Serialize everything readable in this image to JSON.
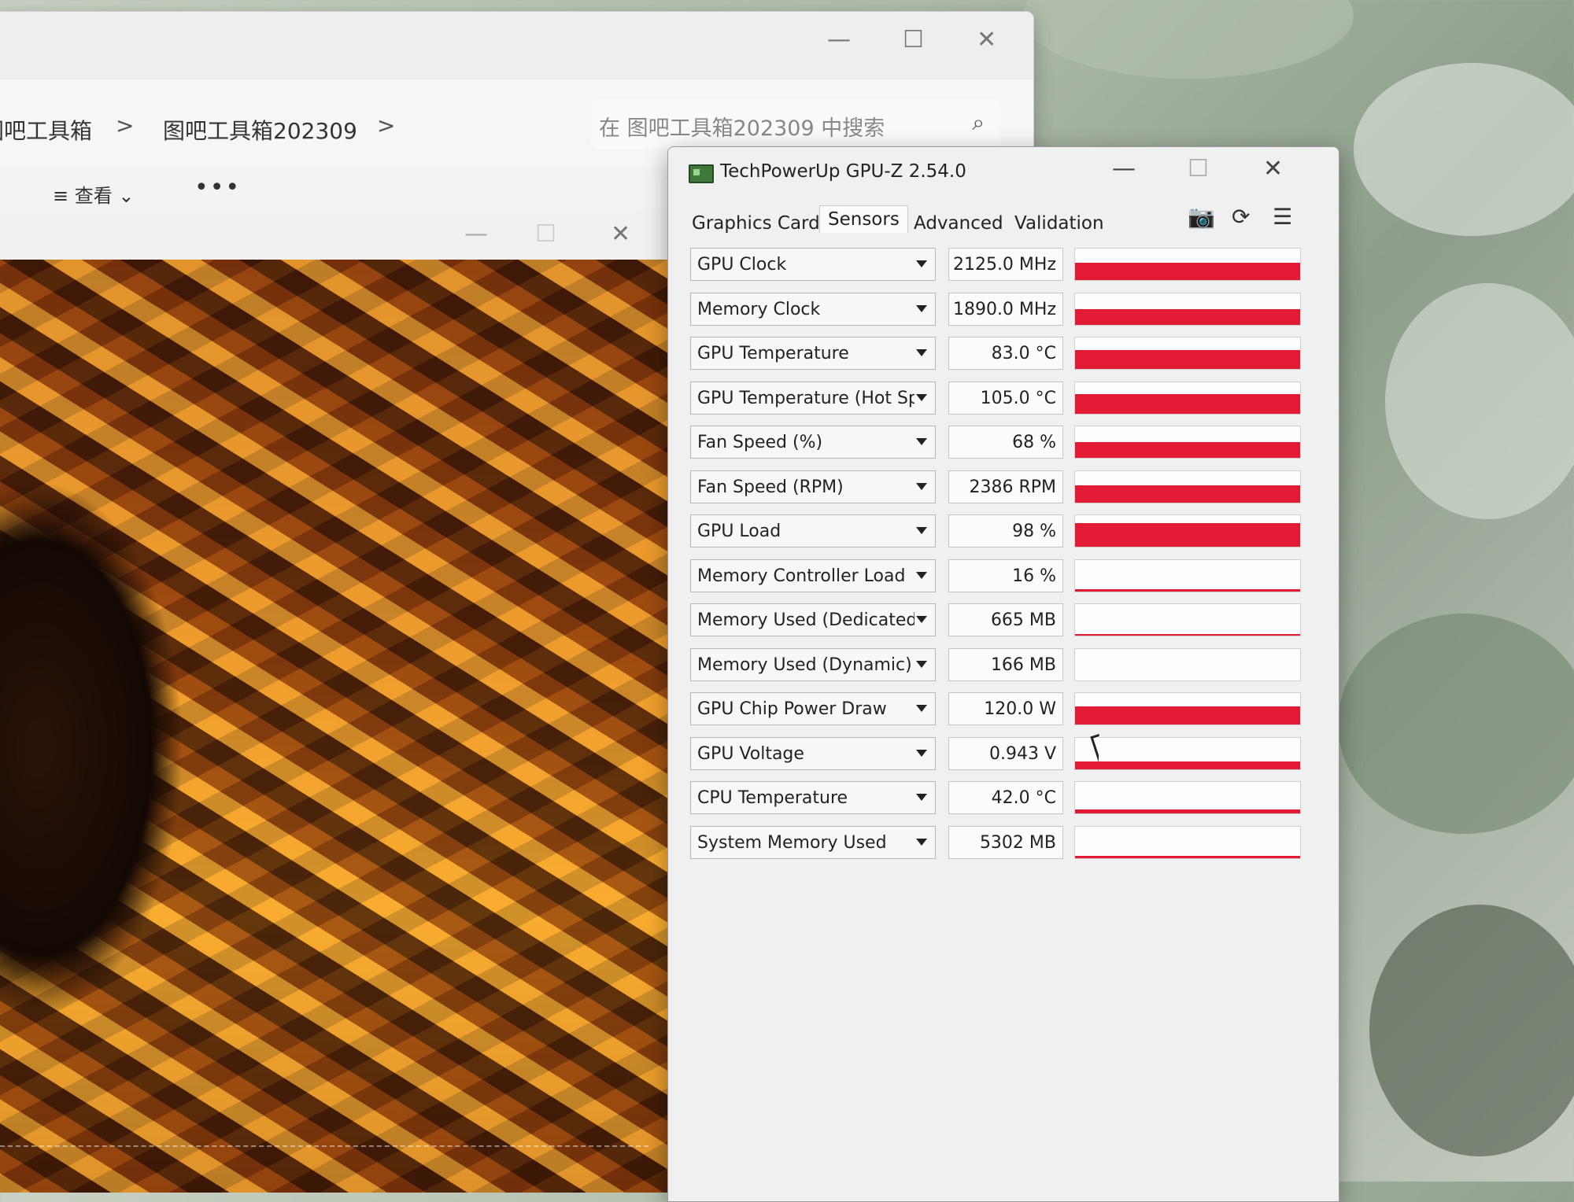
{
  "explorer": {
    "breadcrumb": [
      "图吧工具箱",
      "图吧工具箱202309"
    ],
    "breadcrumb_sep": ">",
    "search_placeholder": "在 图吧工具箱202309 中搜索",
    "toolbar_view": "查看",
    "toolbar_more": "•••",
    "icons": [
      "search-icon",
      "minimize-icon",
      "maximize-icon",
      "close-icon"
    ]
  },
  "gpuz": {
    "title": "TechPowerUp GPU-Z 2.54.0",
    "window_controls": {
      "minimize": "—",
      "maximize": "☐",
      "close": "✕"
    },
    "tabs": [
      "Graphics Card",
      "Sensors",
      "Advanced",
      "Validation"
    ],
    "active_tab": "Sensors",
    "tool_icons": {
      "camera": "camera-icon",
      "refresh": "refresh-icon",
      "menu": "menu-icon"
    },
    "sensors": [
      {
        "label": "GPU Clock",
        "value": "2125.0 MHz",
        "fill": 0.55
      },
      {
        "label": "Memory Clock",
        "value": "1890.0 MHz",
        "fill": 0.5
      },
      {
        "label": "GPU Temperature",
        "value": "83.0 °C",
        "fill": 0.6
      },
      {
        "label": "GPU Temperature (Hot Spot)",
        "value": "105.0 °C",
        "fill": 0.62
      },
      {
        "label": "Fan Speed (%)",
        "value": "68 %",
        "fill": 0.5
      },
      {
        "label": "Fan Speed (RPM)",
        "value": "2386 RPM",
        "fill": 0.55
      },
      {
        "label": "GPU Load",
        "value": "98 %",
        "fill": 0.75
      },
      {
        "label": "Memory Controller Load",
        "value": "16 %",
        "fill": 0.08
      },
      {
        "label": "Memory Used (Dedicated)",
        "value": "665 MB",
        "fill": 0.05
      },
      {
        "label": "Memory Used (Dynamic)",
        "value": "166 MB",
        "fill": 0.0
      },
      {
        "label": "GPU Chip Power Draw",
        "value": "120.0 W",
        "fill": 0.58
      },
      {
        "label": "GPU Voltage",
        "value": "0.943 V",
        "fill": 0.25
      },
      {
        "label": "CPU Temperature",
        "value": "42.0 °C",
        "fill": 0.12
      },
      {
        "label": "System Memory Used",
        "value": "5302 MB",
        "fill": 0.08
      }
    ],
    "graph_color": "#e31a34"
  }
}
